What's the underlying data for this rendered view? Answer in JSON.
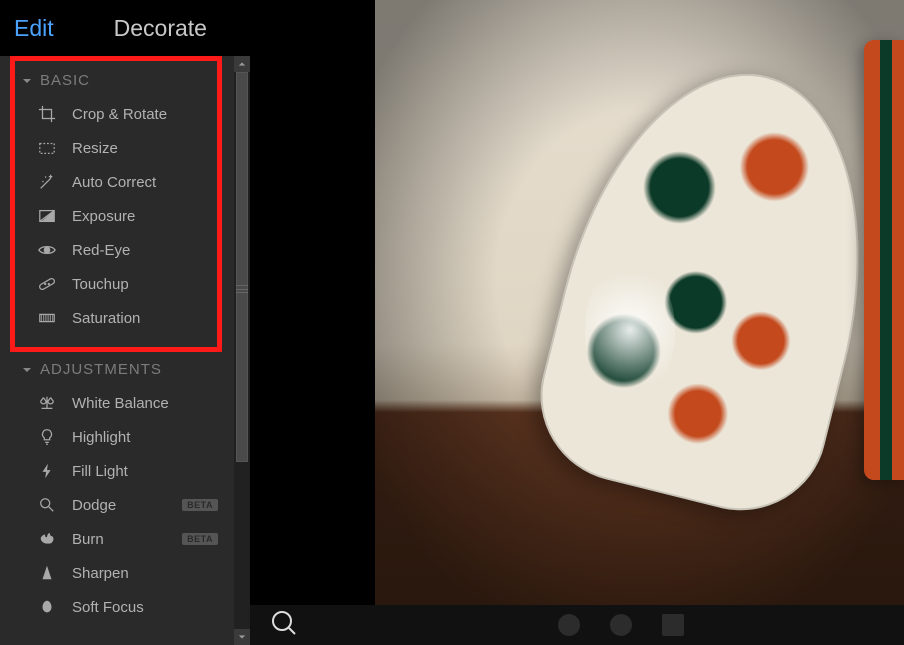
{
  "tabs": {
    "edit": "Edit",
    "decorate": "Decorate"
  },
  "sections": [
    {
      "title": "BASIC",
      "items": [
        {
          "label": "Crop & Rotate",
          "icon": "crop-icon"
        },
        {
          "label": "Resize",
          "icon": "resize-icon"
        },
        {
          "label": "Auto Correct",
          "icon": "wand-icon"
        },
        {
          "label": "Exposure",
          "icon": "exposure-icon"
        },
        {
          "label": "Red-Eye",
          "icon": "eye-icon"
        },
        {
          "label": "Touchup",
          "icon": "bandaid-icon"
        },
        {
          "label": "Saturation",
          "icon": "saturation-icon"
        }
      ]
    },
    {
      "title": "ADJUSTMENTS",
      "items": [
        {
          "label": "White Balance",
          "icon": "balance-icon"
        },
        {
          "label": "Highlight",
          "icon": "bulb-icon"
        },
        {
          "label": "Fill Light",
          "icon": "flash-icon"
        },
        {
          "label": "Dodge",
          "icon": "magnify-icon",
          "badge": "BETA"
        },
        {
          "label": "Burn",
          "icon": "burn-icon",
          "badge": "BETA"
        },
        {
          "label": "Sharpen",
          "icon": "sharpen-icon"
        },
        {
          "label": "Soft Focus",
          "icon": "softfocus-icon"
        }
      ]
    }
  ]
}
